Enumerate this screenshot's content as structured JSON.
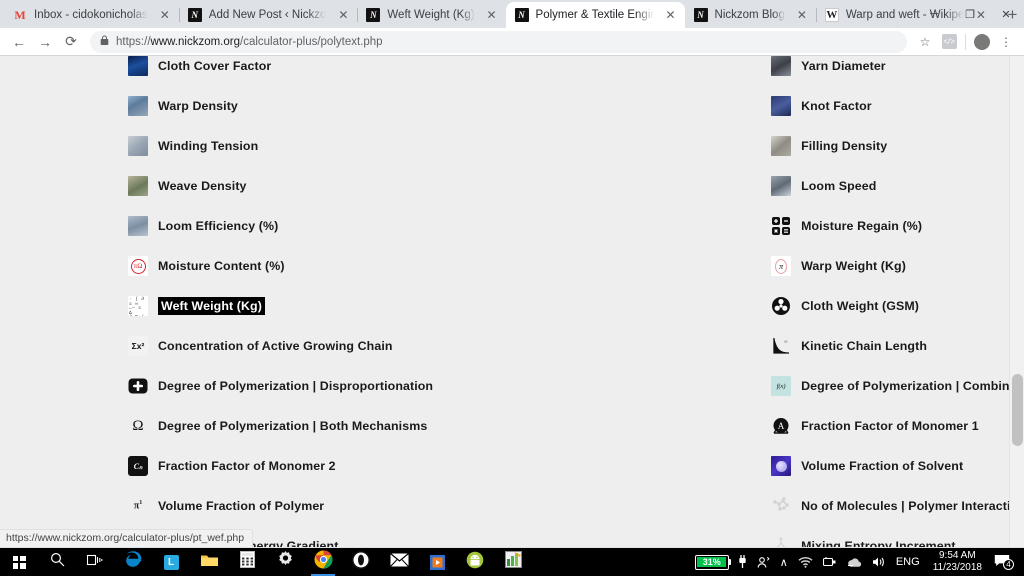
{
  "window": {
    "minimize_label": "─",
    "maximize_label": "❐",
    "close_label": "✕"
  },
  "browser": {
    "tabs": [
      {
        "title": "Inbox - cidokonicholas",
        "favicon": "gmail-icon",
        "active": false
      },
      {
        "title": "Add New Post ‹ Nickzo",
        "favicon": "nickzom-icon",
        "active": false
      },
      {
        "title": "Weft Weight (Kg)",
        "favicon": "nickzom-icon",
        "active": false
      },
      {
        "title": "Polymer & Textile Engin",
        "favicon": "nickzom-icon",
        "active": true
      },
      {
        "title": "Nickzom Blog",
        "favicon": "nickzom-icon",
        "active": false
      },
      {
        "title": "Warp and weft - Wikipe",
        "favicon": "wikipedia-icon",
        "active": false
      }
    ],
    "new_tab_label": "+",
    "close_label": "✕",
    "toolbar": {
      "back_label": "←",
      "forward_label": "→",
      "reload_label": "⟳",
      "lock_label": "🔒",
      "url_scheme": "https://",
      "url_host": "www.nickzom.org",
      "url_path": "/calculator-plus/polytext.php",
      "bookmark_label": "☆",
      "extension_label": "</>",
      "menu_label": "⋮"
    }
  },
  "page": {
    "status_url": "https://www.nickzom.org/calculator-plus/pt_wef.php",
    "background_color": "#eeeeee",
    "selected_item": "Weft Weight (Kg)",
    "rows": [
      {
        "left": {
          "label": "Cloth Cover Factor",
          "icon": "cloth-cover-factor-thumbnail",
          "clipped": true
        },
        "right": {
          "label": "Yarn Diameter",
          "icon": "yarn-diameter-thumbnail",
          "clipped": true
        }
      },
      {
        "left": {
          "label": "Warp Density",
          "icon": "warp-density-thumbnail"
        },
        "right": {
          "label": "Knot Factor",
          "icon": "knot-factor-thumbnail"
        }
      },
      {
        "left": {
          "label": "Winding Tension",
          "icon": "winding-tension-thumbnail"
        },
        "right": {
          "label": "Filling Density",
          "icon": "filling-density-thumbnail"
        }
      },
      {
        "left": {
          "label": "Weave Density",
          "icon": "weave-density-thumbnail"
        },
        "right": {
          "label": "Loom Speed",
          "icon": "loom-speed-thumbnail"
        }
      },
      {
        "left": {
          "label": "Loom Efficiency (%)",
          "icon": "loom-efficiency-thumbnail"
        },
        "right": {
          "label": "Moisture Regain (%)",
          "icon": "calculator-icon"
        }
      },
      {
        "left": {
          "label": "Moisture Content (%)",
          "icon": "red-seal-icon"
        },
        "right": {
          "label": "Warp Weight (Kg)",
          "icon": "pi-oval-icon"
        }
      },
      {
        "left": {
          "label": "Weft Weight (Kg)",
          "icon": "dot-matrix-icon",
          "selected": true
        },
        "right": {
          "label": "Cloth Weight (GSM)",
          "icon": "fan-circle-icon"
        }
      },
      {
        "left": {
          "label": "Concentration of Active Growing Chain",
          "icon": "sigma-x-icon"
        },
        "right": {
          "label": "Kinetic Chain Length",
          "icon": "decay-curve-icon"
        }
      },
      {
        "left": {
          "label": "Degree of Polymerization | Disproportionation",
          "icon": "plus-square-icon"
        },
        "right": {
          "label": "Degree of Polymerization | Combination",
          "icon": "fx-icon"
        }
      },
      {
        "left": {
          "label": "Degree of Polymerization | Both Mechanisms",
          "icon": "omega-icon"
        },
        "right": {
          "label": "Fraction Factor of Monomer 1",
          "icon": "circle-a-icon"
        }
      },
      {
        "left": {
          "label": "Fraction Factor of Monomer 2",
          "icon": "cn-black-icon"
        },
        "right": {
          "label": "Volume Fraction of Solvent",
          "icon": "solvent-sphere-icon"
        }
      },
      {
        "left": {
          "label": "Volume Fraction of Polymer",
          "icon": "pi-faint-icon"
        },
        "right": {
          "label": "No of Molecules | Polymer Interaction",
          "icon": "molecule-icon"
        }
      },
      {
        "left": {
          "label": "Mixing Gibbs Energy Gradient",
          "icon": "green-chart-icon",
          "clipped_bottom": true
        },
        "right": {
          "label": "Mixing Entropy Increment",
          "icon": "entropy-tree-icon",
          "clipped_bottom": true
        }
      }
    ]
  },
  "taskbar": {
    "start_label": "start-button",
    "items": [
      {
        "name": "start-button",
        "icon": "windows-logo-icon"
      },
      {
        "name": "search-button",
        "icon": "search-icon"
      },
      {
        "name": "task-view-button",
        "icon": "task-view-icon"
      },
      {
        "name": "edge-button",
        "icon": "edge-icon"
      },
      {
        "name": "app-l-button",
        "icon": "letter-l-icon"
      },
      {
        "name": "file-explorer-button",
        "icon": "folder-icon"
      },
      {
        "name": "calculator-button",
        "icon": "calculator-icon"
      },
      {
        "name": "settings-button",
        "icon": "gear-icon"
      },
      {
        "name": "chrome-button",
        "icon": "chrome-icon",
        "running": true
      },
      {
        "name": "opera-button",
        "icon": "opera-icon"
      },
      {
        "name": "mail-button",
        "icon": "mail-icon"
      },
      {
        "name": "media-player-button",
        "icon": "play-orange-icon"
      },
      {
        "name": "android-studio-button",
        "icon": "android-icon"
      },
      {
        "name": "excel-button",
        "icon": "spreadsheet-icon"
      }
    ],
    "tray": {
      "battery_percent": "31%",
      "plug_icon": "power-plug-icon",
      "people_icon": "people-icon",
      "chevron_icon": "∧",
      "wifi_icon": "wifi-icon",
      "usb_icon": "usb-icon",
      "onedrive_icon": "onedrive-icon",
      "volume_icon": "speaker-icon",
      "language": "ENG",
      "time": "9:54 AM",
      "date": "11/23/2018",
      "notification_count": "4",
      "notification_icon": "notification-icon"
    }
  }
}
